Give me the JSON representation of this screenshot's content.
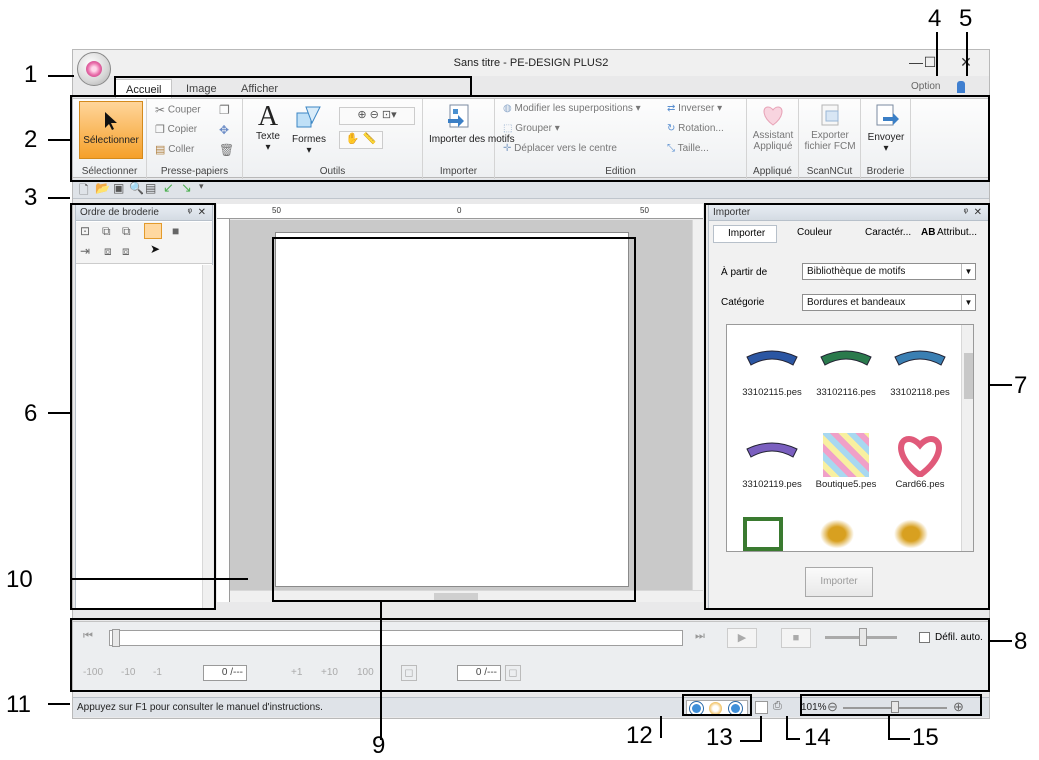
{
  "window": {
    "title": "Sans titre - PE-DESIGN PLUS2",
    "minimize": "—",
    "maximize": "☐",
    "close": "✕",
    "option": "Option"
  },
  "tabs": [
    "Accueil",
    "Image",
    "Afficher"
  ],
  "ribbon": {
    "select": {
      "label": "Sélectionner",
      "group": "Sélectionner"
    },
    "clipboard": {
      "cut": "Couper",
      "copy": "Copier",
      "paste": "Coller",
      "group": "Presse-papiers"
    },
    "tools": {
      "text": "Texte",
      "shapes": "Formes",
      "group": "Outils"
    },
    "import": {
      "label": "Importer des motifs",
      "group": "Importer"
    },
    "edit": {
      "overlap": "Modifier les superpositions",
      "group_btn": "Grouper",
      "center": "Déplacer vers le centre",
      "invert": "Inverser",
      "rotate": "Rotation...",
      "size": "Taille...",
      "group": "Edition"
    },
    "applique": {
      "label": "Assistant Appliqué",
      "group": "Appliqué"
    },
    "scanncut": {
      "label": "Exporter fichier FCM",
      "group": "ScanNCut"
    },
    "embroidery": {
      "label": "Envoyer",
      "group": "Broderie"
    }
  },
  "order_panel": {
    "title": "Ordre de broderie",
    "pin": "ᵠ",
    "close": "✕"
  },
  "ruler": {
    "labels": [
      "50",
      "0",
      "50"
    ]
  },
  "import_panel": {
    "title": "Importer",
    "tabs": [
      "Importer",
      "Couleur",
      "Caractér...",
      "Attribut..."
    ],
    "from_label": "À partir de",
    "from_value": "Bibliothèque de motifs",
    "category_label": "Catégorie",
    "category_value": "Bordures et bandeaux",
    "items": [
      {
        "name": "33102115.pes",
        "color": "#2b56a3"
      },
      {
        "name": "33102116.pes",
        "color": "#2a7a4c"
      },
      {
        "name": "33102118.pes",
        "color": "#3a7fb3"
      },
      {
        "name": "33102119.pes",
        "color": "#7a5fbf"
      },
      {
        "name": "Boutique5.pes",
        "color": "#f0a0c8"
      },
      {
        "name": "Card66.pes",
        "color": "#e05a7a"
      }
    ],
    "button": "Importer"
  },
  "player": {
    "auto_scroll": "Défil. auto.",
    "stitch_buttons": [
      "-100",
      "-10",
      "-1",
      "+1",
      "+10",
      "100"
    ],
    "counter1": "0 /---",
    "counter2": "0 /---"
  },
  "status": {
    "hint": "Appuyez sur F1 pour consulter le manuel d'instructions.",
    "zoom": "101%"
  },
  "callouts": [
    "1",
    "2",
    "3",
    "4",
    "5",
    "6",
    "7",
    "8",
    "9",
    "10",
    "11",
    "12",
    "13",
    "14",
    "15"
  ]
}
